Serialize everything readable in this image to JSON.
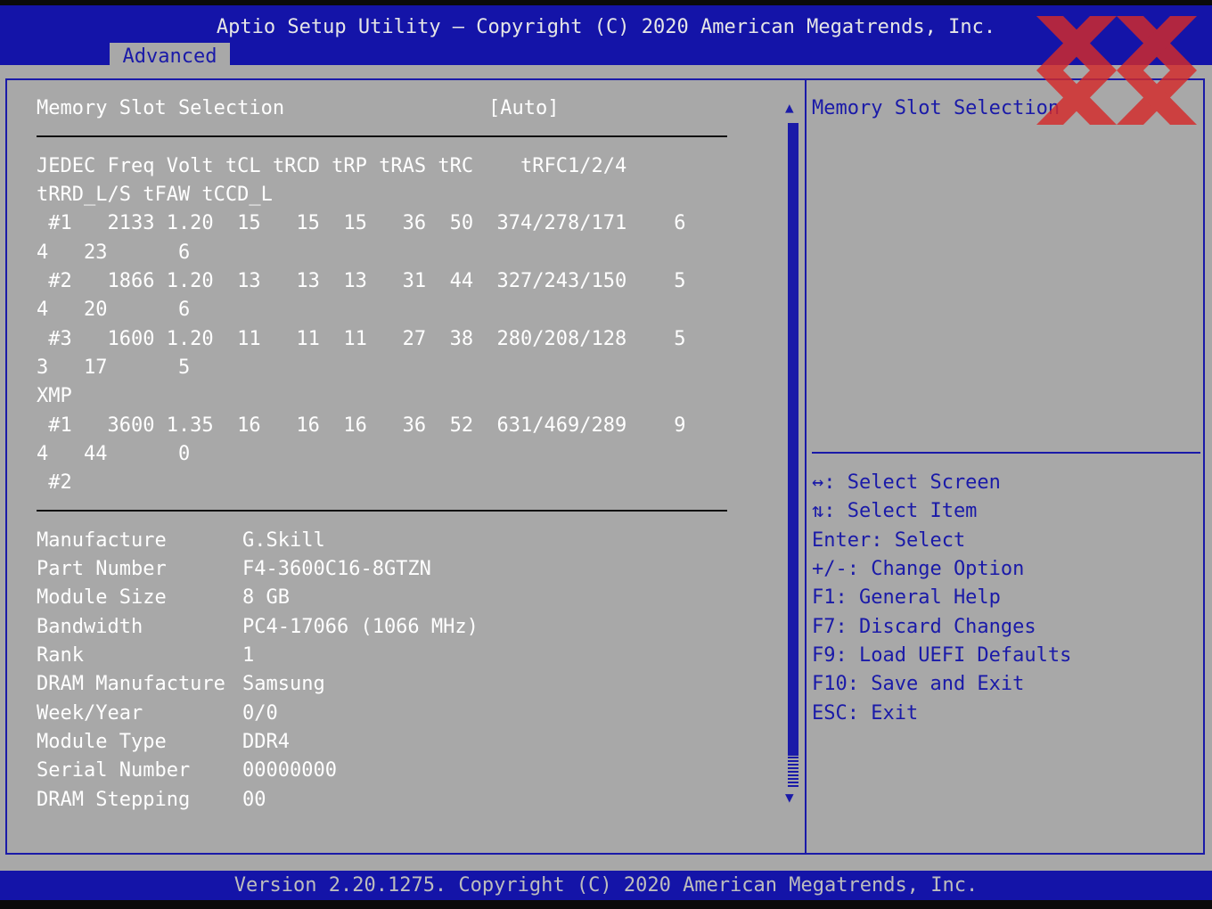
{
  "header": {
    "title": "Aptio Setup Utility – Copyright (C) 2020 American Megatrends, Inc.",
    "tab": "Advanced"
  },
  "setting": {
    "label": "Memory Slot Selection",
    "value": "[Auto]"
  },
  "timings": {
    "header_line1": "JEDEC Freq Volt tCL tRCD tRP tRAS tRC    tRFC1/2/4",
    "header_line2": "tRRD_L/S tFAW tCCD_L",
    "rows": [
      " #1   2133 1.20  15   15  15   36  50  374/278/171    6",
      "4   23      6",
      " #2   1866 1.20  13   13  13   31  44  327/243/150    5",
      "4   20      6",
      " #3   1600 1.20  11   11  11   27  38  280/208/128    5",
      "3   17      5",
      "XMP",
      " #1   3600 1.35  16   16  16   36  52  631/469/289    9",
      "4   44      0",
      " #2"
    ]
  },
  "module_info": [
    {
      "label": "Manufacture",
      "value": "G.Skill"
    },
    {
      "label": "Part Number",
      "value": "F4-3600C16-8GTZN"
    },
    {
      "label": "Module Size",
      "value": "8 GB"
    },
    {
      "label": "Bandwidth",
      "value": "PC4-17066 (1066 MHz)"
    },
    {
      "label": "Rank",
      "value": "1"
    },
    {
      "label": "DRAM Manufacture",
      "value": "Samsung"
    },
    {
      "label": "Week/Year",
      "value": "0/0"
    },
    {
      "label": "Module Type",
      "value": "DDR4"
    },
    {
      "label": "Serial Number",
      "value": "00000000"
    },
    {
      "label": "DRAM Stepping",
      "value": "00"
    }
  ],
  "help": {
    "description": "Memory Slot Selection",
    "keys": [
      "↔: Select Screen",
      "⇅: Select Item",
      "Enter: Select",
      "+/-: Change Option",
      "F1: General Help",
      "F7: Discard Changes",
      "F9: Load UEFI Defaults",
      "F10: Save and Exit",
      "ESC: Exit"
    ]
  },
  "scrollbar": {
    "up_icon": "▲",
    "down_icon": "▼"
  },
  "footer": {
    "text": "Version 2.20.1275. Copyright (C) 2020 American Megatrends, Inc."
  },
  "colors": {
    "bar_blue": "#1414a8",
    "panel_gray": "#a8a8a8",
    "text_white": "#ffffff",
    "text_blue": "#1a1aa8",
    "watermark_red": "#d42a2a"
  }
}
